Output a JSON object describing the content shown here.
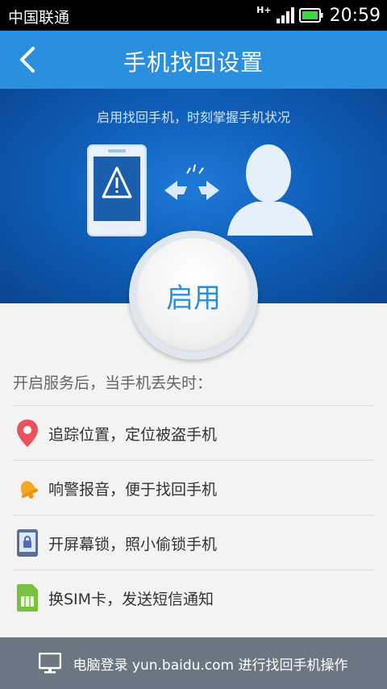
{
  "status_bar": {
    "carrier": "中国联通",
    "network_type": "H+",
    "time": "20:59",
    "battery_color": "#3ed63e"
  },
  "header": {
    "title": "手机找回设置",
    "back_icon": "chevron-left-icon",
    "background_color": "#2b8fe0"
  },
  "banner": {
    "caption": "启用找回手机，时刻掌握手机状况"
  },
  "enable_button": {
    "label": "启用"
  },
  "intro": "开启服务后，当手机丢失时：",
  "features": [
    {
      "icon": "location-pin-icon",
      "text": "追踪位置，定位被盗手机",
      "color": "#e8525a"
    },
    {
      "icon": "alarm-bell-icon",
      "text": "响警报音，便于找回手机",
      "color": "#f5a623"
    },
    {
      "icon": "screen-lock-icon",
      "text": "开屏幕锁，照小偷锁手机",
      "color": "#4f6fb5"
    },
    {
      "icon": "sim-card-icon",
      "text": "换SIM卡，发送短信通知",
      "color": "#7ac142"
    }
  ],
  "footer": {
    "icon": "monitor-icon",
    "text": "电脑登录 yun.baidu.com 进行找回手机操作"
  }
}
